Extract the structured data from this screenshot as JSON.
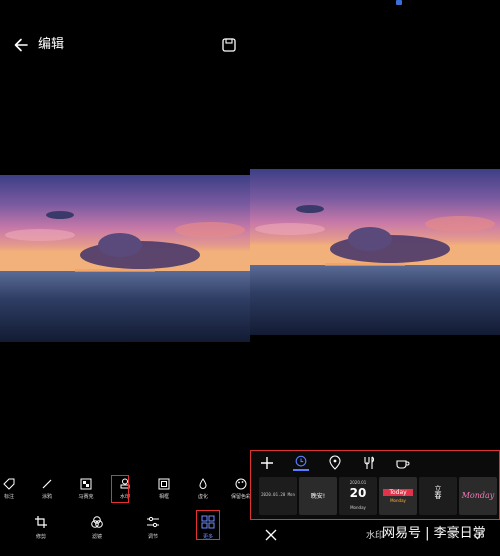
{
  "status_bar": {
    "indicator_color": "#3a6fd8"
  },
  "left": {
    "header": {
      "title": "编辑",
      "back_icon": "arrow-left-icon",
      "save_icon": "save-icon"
    },
    "tools": [
      {
        "label": "标注",
        "icon": "tag-icon",
        "selected": false
      },
      {
        "label": "涂鸦",
        "icon": "brush-icon",
        "selected": false
      },
      {
        "label": "马赛克",
        "icon": "mosaic-icon",
        "selected": false
      },
      {
        "label": "水印",
        "icon": "stamp-icon",
        "selected": true
      },
      {
        "label": "相框",
        "icon": "frame-icon",
        "selected": false
      },
      {
        "label": "虚化",
        "icon": "blur-drop-icon",
        "selected": false
      },
      {
        "label": "保留色彩",
        "icon": "palette-icon",
        "selected": false
      }
    ],
    "nav": [
      {
        "label": "修剪",
        "icon": "crop-icon",
        "active": false
      },
      {
        "label": "滤镜",
        "icon": "filter-icon",
        "active": false
      },
      {
        "label": "调节",
        "icon": "sliders-icon",
        "active": false
      },
      {
        "label": "更多",
        "icon": "grid-icon",
        "active": true
      }
    ]
  },
  "right": {
    "watermark_panel": {
      "tabs": [
        {
          "icon": "plus-icon",
          "active": false
        },
        {
          "icon": "clock-icon",
          "active": true
        },
        {
          "icon": "location-pin-icon",
          "active": false
        },
        {
          "icon": "fork-knife-icon",
          "active": false
        },
        {
          "icon": "coffee-cup-icon",
          "active": false
        }
      ],
      "thumbnails": [
        {
          "style": "plain-date",
          "text": "2020.01.20  Mon"
        },
        {
          "style": "stamp",
          "text": "晚安!"
        },
        {
          "style": "calendar",
          "big": "20",
          "small_top": "2020.01",
          "small_bottom": "Monday"
        },
        {
          "style": "today",
          "big": "Today",
          "small": "Monday"
        },
        {
          "style": "vertical",
          "text": "立春"
        },
        {
          "style": "script",
          "text": "Monday"
        }
      ]
    },
    "bottom": {
      "label": "水印",
      "cancel_icon": "close-icon",
      "confirm_icon": "check-icon"
    },
    "credit": "网易号 | 李豪日常"
  },
  "colors": {
    "accent": "#5a7cff",
    "selection_border": "#e53030",
    "background": "#000000"
  }
}
